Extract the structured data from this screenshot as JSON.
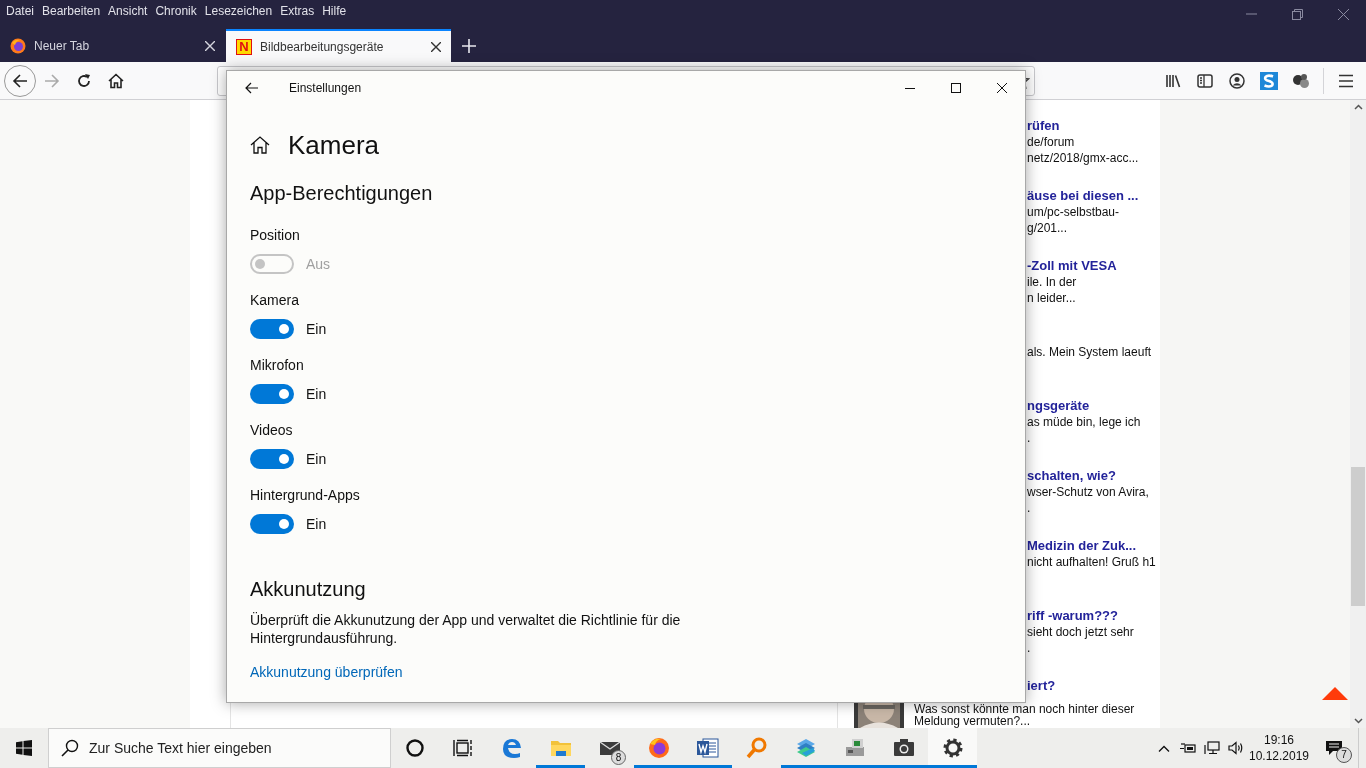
{
  "browser": {
    "menu": [
      "Datei",
      "Bearbeiten",
      "Ansicht",
      "Chronik",
      "Lesezeichen",
      "Extras",
      "Hilfe"
    ],
    "tabs": [
      {
        "title": "Neuer Tab",
        "kind": "firefox",
        "selected": false
      },
      {
        "title": "Bildbearbeitungsgeräte",
        "kind": "letter",
        "favicon_text": "N",
        "selected": true
      }
    ],
    "forward_disabled": true
  },
  "page": {
    "posts": [
      {
        "title": "rüfen",
        "lines": [
          "de/forum",
          "netz/2018/gmx-acc..."
        ]
      },
      {
        "title": "äuse bei diesen ...",
        "lines": [
          "um/pc-selbstbau-",
          "g/201..."
        ]
      },
      {
        "title": "-Zoll mit VESA",
        "lines": [
          "ile. In der",
          "n leider..."
        ]
      },
      {
        "lines": [
          "als. Mein System laeuft"
        ]
      },
      {
        "title": "ngsgeräte",
        "lines": [
          "as müde bin, lege ich",
          "."
        ]
      },
      {
        "title": "schalten, wie?",
        "lines": [
          "wser-Schutz von Avira,",
          "."
        ]
      },
      {
        "title": "Medizin der Zuk...",
        "lines": [
          "nicht aufhalten! Gruß h1"
        ]
      },
      {
        "title": "riff -warum???",
        "lines": [
          "sieht doch jetzt sehr",
          "."
        ]
      },
      {
        "title": "iert?",
        "lines": [
          "Was sonst könnte man noch hinter dieser",
          "Meldung vermuten?..."
        ],
        "avatar": true
      }
    ]
  },
  "settings": {
    "window_title": "Einstellungen",
    "heading": "Kamera",
    "section": "App-Berechtigungen",
    "permissions": [
      {
        "label": "Position",
        "on": false,
        "disabled": true,
        "state_text": "Aus"
      },
      {
        "label": "Kamera",
        "on": true,
        "disabled": false,
        "state_text": "Ein"
      },
      {
        "label": "Mikrofon",
        "on": true,
        "disabled": false,
        "state_text": "Ein"
      },
      {
        "label": "Videos",
        "on": true,
        "disabled": false,
        "state_text": "Ein"
      },
      {
        "label": "Hintergrund-Apps",
        "on": true,
        "disabled": false,
        "state_text": "Ein"
      }
    ],
    "battery": {
      "heading": "Akkunutzung",
      "description": "Überprüft die Akkunutzung der App und verwaltet die Richtlinie für die Hintergrundausführung.",
      "link": "Akkunutzung überprüfen"
    }
  },
  "taskbar": {
    "search": {
      "placeholder": "Zur Suche Text hier eingeben"
    },
    "apps": [
      {
        "kind": "edge",
        "running": false,
        "active": false
      },
      {
        "kind": "explorer",
        "running": true,
        "active": false
      },
      {
        "kind": "mail",
        "running": false,
        "active": false,
        "badge": "8"
      },
      {
        "kind": "firefox",
        "running": true,
        "active": false
      },
      {
        "kind": "word",
        "running": true,
        "active": false
      },
      {
        "kind": "magnifier",
        "running": false,
        "active": false
      },
      {
        "kind": "stack",
        "running": true,
        "active": false
      },
      {
        "kind": "scanner",
        "running": true,
        "active": false
      },
      {
        "kind": "camera",
        "running": true,
        "active": false
      },
      {
        "kind": "settings",
        "running": true,
        "active": true
      }
    ],
    "time": "19:16",
    "date": "10.12.2019",
    "notifications": "7"
  }
}
